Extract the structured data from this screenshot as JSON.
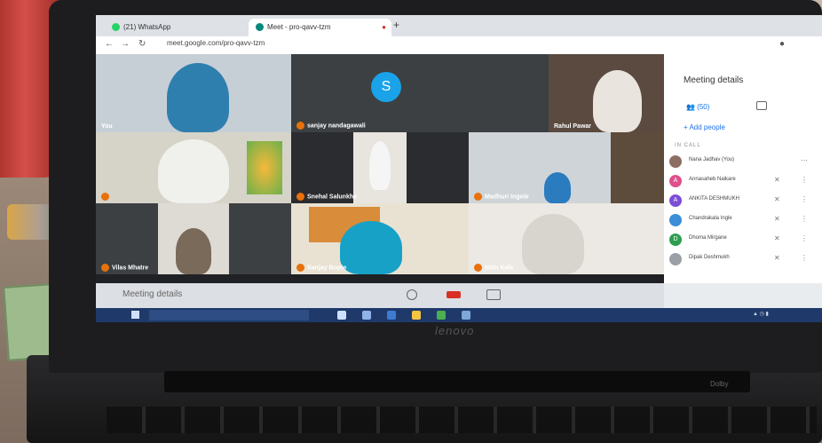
{
  "browser": {
    "tabs": [
      {
        "label": "(21) WhatsApp",
        "icon": "whatsapp-icon"
      },
      {
        "label": "Meet - pro-qavv-tzm",
        "icon": "meet-icon"
      }
    ],
    "url": "meet.google.com/pro-qavv-tzm"
  },
  "meeting": {
    "tiles": [
      {
        "name": "You"
      },
      {
        "name": "sanjay nandagawali",
        "initial": "S"
      },
      {
        "name": "Rahul Pawar"
      },
      {
        "name": ""
      },
      {
        "name": "Snehal Salunkhe"
      },
      {
        "name": "Madhuri Ingole"
      },
      {
        "name": "Vilas Mhatre"
      },
      {
        "name": "Sanjay Bopte"
      },
      {
        "name": "Nitin Kale"
      }
    ],
    "bottom_label": "Meeting details"
  },
  "panel": {
    "title": "Meeting details",
    "people_count": "(50)",
    "add_people": "Add people",
    "in_call": "IN CALL",
    "participants": [
      {
        "name": "Nana Jadhav (You)",
        "initial": "",
        "color": "#8d6e63"
      },
      {
        "name": "Annasaheb Naikare",
        "initial": "A",
        "color": "#e04f8a"
      },
      {
        "name": "ANKITA DESHMUKH",
        "initial": "A",
        "color": "#7b4ed6"
      },
      {
        "name": "Chandrakala Ingle",
        "initial": "",
        "color": "#3a8fd6"
      },
      {
        "name": "Dhoma Mirgane",
        "initial": "D",
        "color": "#2e9e4f"
      },
      {
        "name": "Dipak Deshmukh",
        "initial": "",
        "color": "#9aa0a6"
      }
    ]
  },
  "laptop": {
    "brand": "lenovo",
    "sticker": "Dolby"
  }
}
